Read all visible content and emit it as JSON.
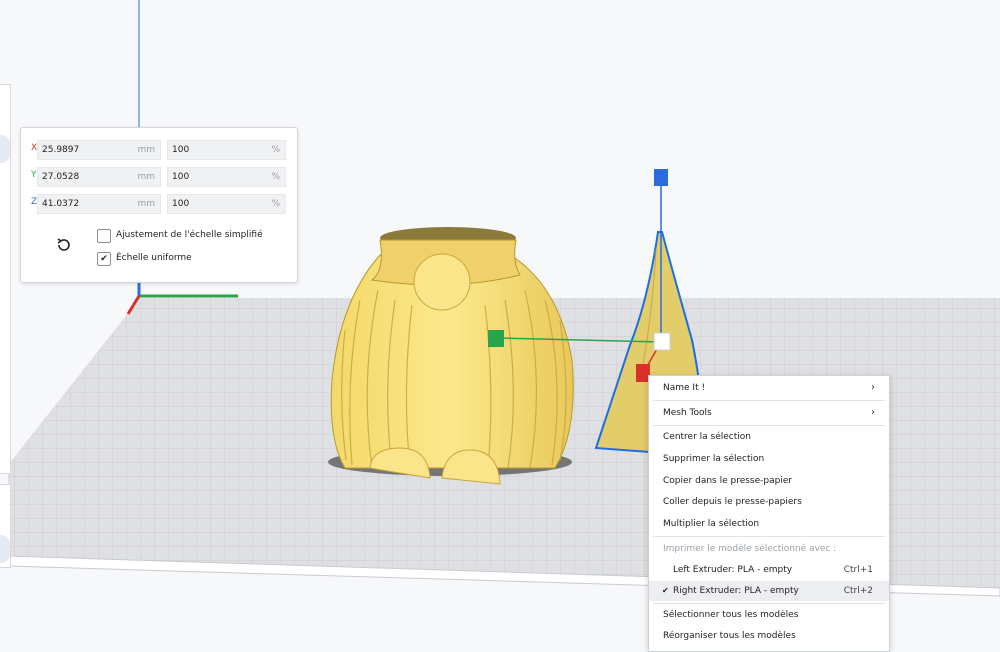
{
  "scale_panel": {
    "rows": [
      {
        "axis": "X",
        "mm": "25.9897",
        "mm_unit": "mm",
        "pct": "100",
        "pct_unit": "%",
        "color": "#d9302c"
      },
      {
        "axis": "Y",
        "mm": "27.0528",
        "mm_unit": "mm",
        "pct": "100",
        "pct_unit": "%",
        "color": "#2aa44a"
      },
      {
        "axis": "Z",
        "mm": "41.0372",
        "mm_unit": "mm",
        "pct": "100",
        "pct_unit": "%",
        "color": "#2c6cd9"
      }
    ],
    "snap_scaling_label": "Ajustement de l'échelle simplifié",
    "snap_scaling_checked": false,
    "uniform_scaling_label": "Échelle uniforme",
    "uniform_scaling_checked": true,
    "reset_icon": "reset-icon"
  },
  "context_menu": {
    "name_it": "Name It !",
    "mesh_tools": "Mesh Tools",
    "center_selection": "Centrer la sélection",
    "delete_selection": "Supprimer la sélection",
    "copy_clipboard": "Copier dans le presse-papier",
    "paste_clipboard": "Coller depuis le presse-papiers",
    "multiply_selection": "Multiplier la sélection",
    "print_with_header": "Imprimer le modèle sélectionné avec :",
    "left_extruder": "Left Extruder: PLA - empty",
    "left_shortcut": "Ctrl+1",
    "right_extruder": "Right Extruder: PLA - empty",
    "right_shortcut": "Ctrl+2",
    "select_all": "Sélectionner tous les modèles",
    "arrange_all": "Réorganiser tous les modèles"
  },
  "colors": {
    "model_fill": "#f7e07a",
    "model_stroke": "#b89a2a",
    "selection_outline": "#1e6fe0",
    "build_plate": "#dcdde0"
  }
}
